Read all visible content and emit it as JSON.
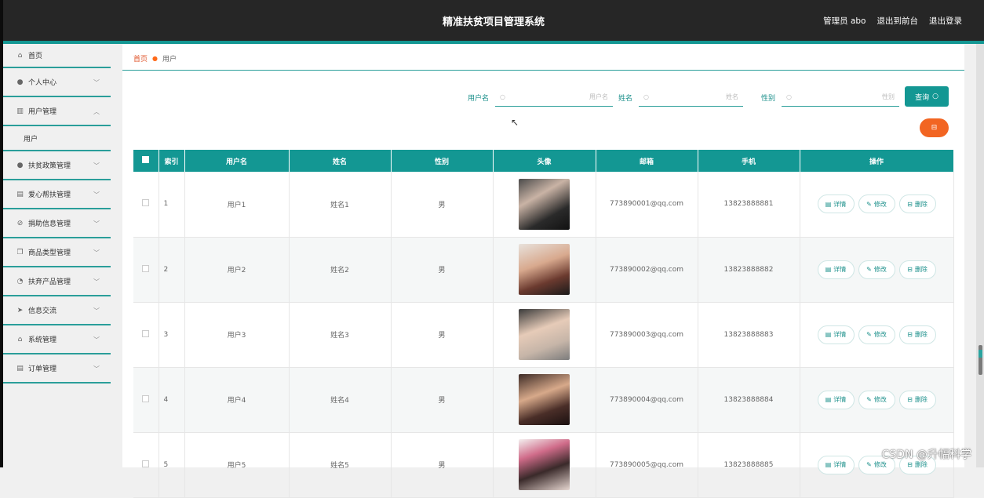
{
  "header": {
    "title": "精准扶贫项目管理系统",
    "admin": "管理员 abo",
    "exit_front": "退出到前台",
    "logout": "退出登录"
  },
  "sidebar": {
    "items": [
      {
        "label": "首页",
        "icon": "home-icon"
      },
      {
        "label": "个人中心",
        "icon": "person-icon"
      },
      {
        "label": "用户管理",
        "icon": "chart-icon"
      },
      {
        "label": "扶贫政策管理",
        "icon": "person-icon"
      },
      {
        "label": "爱心帮扶管理",
        "icon": "doc-icon"
      },
      {
        "label": "捐助信息管理",
        "icon": "compass-icon"
      },
      {
        "label": "商品类型管理",
        "icon": "copy-icon"
      },
      {
        "label": "扶弃产品管理",
        "icon": "gauge-icon"
      },
      {
        "label": "信息交流",
        "icon": "send-icon"
      },
      {
        "label": "系统管理",
        "icon": "bank-icon"
      },
      {
        "label": "订单管理",
        "icon": "doc-icon"
      }
    ],
    "sub_user": "用户"
  },
  "breadcrumb": {
    "home": "首页",
    "current": "用户"
  },
  "search": {
    "username_label": "用户名",
    "username_placeholder": "用户名",
    "name_label": "姓名",
    "name_placeholder": "姓名",
    "gender_label": "性别",
    "gender_placeholder": "性别",
    "query_button": "查询"
  },
  "table": {
    "headers": {
      "index": "索引",
      "username": "用户名",
      "name": "姓名",
      "gender": "性别",
      "avatar": "头像",
      "email": "邮箱",
      "phone": "手机",
      "actions": "操作"
    },
    "action_labels": {
      "detail": "详情",
      "edit": "修改",
      "delete": "删除"
    },
    "rows": [
      {
        "index": "1",
        "username": "用户1",
        "name": "姓名1",
        "gender": "男",
        "email": "773890001@qq.com",
        "phone": "13823888881"
      },
      {
        "index": "2",
        "username": "用户2",
        "name": "姓名2",
        "gender": "男",
        "email": "773890002@qq.com",
        "phone": "13823888882"
      },
      {
        "index": "3",
        "username": "用户3",
        "name": "姓名3",
        "gender": "男",
        "email": "773890003@qq.com",
        "phone": "13823888883"
      },
      {
        "index": "4",
        "username": "用户4",
        "name": "姓名4",
        "gender": "男",
        "email": "773890004@qq.com",
        "phone": "13823888884"
      },
      {
        "index": "5",
        "username": "用户5",
        "name": "姓名5",
        "gender": "男",
        "email": "773890005@qq.com",
        "phone": "13823888885"
      }
    ]
  },
  "watermark": "CSDN @升幅科学",
  "colors": {
    "primary": "#139793",
    "danger": "#f26522",
    "header_bg": "#262626"
  }
}
